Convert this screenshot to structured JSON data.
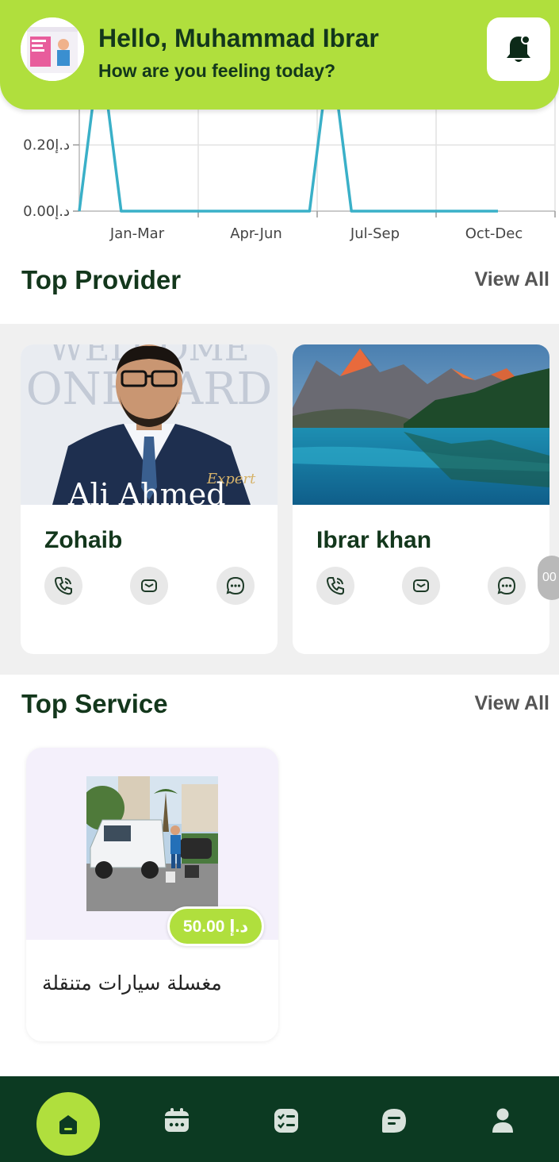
{
  "header": {
    "greeting": "Hello, Muhammad Ibrar",
    "subtitle": "How are you feeling today?"
  },
  "chart_data": {
    "type": "line",
    "categories": [
      "Jan-Mar",
      "Apr-Jun",
      "Jul-Sep",
      "Oct-Dec"
    ],
    "x": [
      0.0,
      0.05,
      0.1,
      0.55,
      0.6,
      0.65,
      1.0
    ],
    "yticks": [
      "0.20د.إ",
      "0.00د.إ"
    ],
    "ytick_values": [
      0.2,
      0.0
    ],
    "ylim": [
      0,
      0.35
    ],
    "series": [
      {
        "values": [
          0.0,
          0.5,
          0.0,
          0.0,
          0.5,
          0.0,
          0.0
        ],
        "color": "#3ab0c8"
      }
    ],
    "grid": true
  },
  "top_provider": {
    "title": "Top Provider",
    "view_all": "View All",
    "providers": [
      {
        "name": "Zohaib",
        "photo_text_1": "WELCOME",
        "photo_text_2": "ONBOARD",
        "photo_caption": "Ali Ahmed",
        "photo_tag": "Expert"
      },
      {
        "name": "Ibrar khan"
      }
    ],
    "more_indicator": "00"
  },
  "top_service": {
    "title": "Top Service",
    "view_all": "View All",
    "services": [
      {
        "name": "مغسلة سيارات متنقلة",
        "price": "50.00 د.إ"
      }
    ]
  },
  "colors": {
    "accent": "#b0df3d",
    "dark": "#0c3a22",
    "line": "#3ab0c8"
  },
  "nav": [
    "home-icon",
    "calendar-icon",
    "checklist-icon",
    "chat-icon",
    "profile-icon"
  ]
}
